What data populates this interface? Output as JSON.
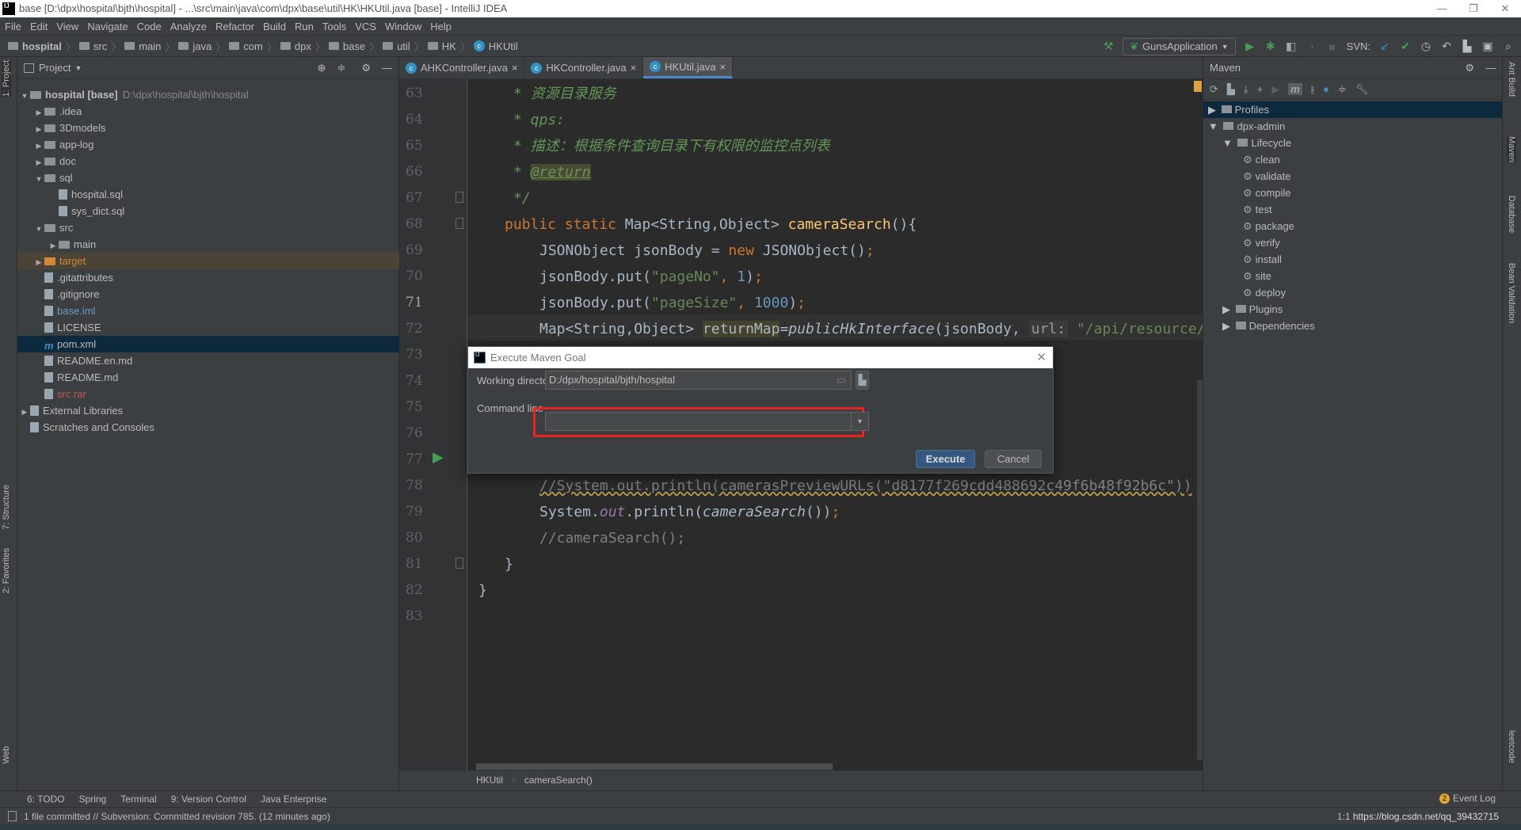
{
  "window": {
    "title": "base [D:\\dpx\\hospital\\bjth\\hospital] - ...\\src\\main\\java\\com\\dpx\\base\\util\\HK\\HKUtil.java [base] - IntelliJ IDEA",
    "logo": "IJ"
  },
  "menu": [
    "File",
    "Edit",
    "View",
    "Navigate",
    "Code",
    "Analyze",
    "Refactor",
    "Build",
    "Run",
    "Tools",
    "VCS",
    "Window",
    "Help"
  ],
  "navbar": [
    "hospital",
    "src",
    "main",
    "java",
    "com",
    "dpx",
    "base",
    "util",
    "HK",
    "HKUtil"
  ],
  "toolbar": {
    "run_config": "GunsApplication",
    "svn_label": "SVN:"
  },
  "left_stripe": [
    "1: Project",
    "7: Structure",
    "2: Favorites",
    "Web"
  ],
  "project": {
    "header": "Project",
    "tree": [
      {
        "label": "hospital [base]",
        "extra": "D:\\dpx\\hospital\\bjth\\hospital",
        "level": 0,
        "type": "folder",
        "expanded": true
      },
      {
        "label": ".idea",
        "level": 1,
        "type": "folder"
      },
      {
        "label": "3Dmodels",
        "level": 1,
        "type": "folder"
      },
      {
        "label": "app-log",
        "level": 1,
        "type": "folder"
      },
      {
        "label": "doc",
        "level": 1,
        "type": "folder"
      },
      {
        "label": "sql",
        "level": 1,
        "type": "folder",
        "expanded": true
      },
      {
        "label": "hospital.sql",
        "level": 2,
        "type": "file"
      },
      {
        "label": "sys_dict.sql",
        "level": 2,
        "type": "file"
      },
      {
        "label": "src",
        "level": 1,
        "type": "folder",
        "expanded": true
      },
      {
        "label": "main",
        "level": 2,
        "type": "folder"
      },
      {
        "label": "target",
        "level": 1,
        "type": "folder",
        "color": "#d08a36",
        "highlight": "#4b4335"
      },
      {
        "label": ".gitattributes",
        "level": 1,
        "type": "file"
      },
      {
        "label": ".gitignore",
        "level": 1,
        "type": "file"
      },
      {
        "label": "base.iml",
        "level": 1,
        "type": "file",
        "color": "#6c9dc6"
      },
      {
        "label": "LICENSE",
        "level": 1,
        "type": "file"
      },
      {
        "label": "pom.xml",
        "level": 1,
        "type": "file",
        "selected": true
      },
      {
        "label": "README.en.md",
        "level": 1,
        "type": "file"
      },
      {
        "label": "README.md",
        "level": 1,
        "type": "file"
      },
      {
        "label": "src.rar",
        "level": 1,
        "type": "file",
        "color": "#c75450"
      },
      {
        "label": "External Libraries",
        "level": 0,
        "type": "lib"
      },
      {
        "label": "Scratches and Consoles",
        "level": 0,
        "type": "scratch"
      }
    ]
  },
  "tabs": [
    {
      "label": "AHKController.java"
    },
    {
      "label": "HKController.java"
    },
    {
      "label": "HKUtil.java",
      "active": true
    }
  ],
  "editor": {
    "lines": [
      {
        "n": "63",
        "ind": 4,
        "t": [
          [
            "cm",
            "* 资源目录服务"
          ]
        ]
      },
      {
        "n": "64",
        "ind": 4,
        "t": [
          [
            "cm",
            "* qps:"
          ]
        ]
      },
      {
        "n": "65",
        "ind": 4,
        "t": [
          [
            "cm",
            "* 描述：根据条件查询目录下有权限的监控点列表"
          ]
        ]
      },
      {
        "n": "66",
        "ind": 4,
        "t": [
          [
            "cm",
            "* "
          ],
          [
            "tag",
            "@return"
          ]
        ]
      },
      {
        "n": "67",
        "ind": 4,
        "t": [
          [
            "cm",
            "*/"
          ]
        ]
      },
      {
        "n": "68",
        "ind": 3,
        "t": [
          [
            "kw",
            "public static "
          ],
          [
            "",
            "Map<String,Object> "
          ],
          [
            "fn",
            "cameraSearch"
          ],
          [
            "",
            "(){"
          ]
        ]
      },
      {
        "n": "69",
        "ind": 7,
        "t": [
          [
            "",
            "JSONObject jsonBody = "
          ],
          [
            "kw",
            "new "
          ],
          [
            "",
            "JSONObject()"
          ],
          [
            "kw",
            ";"
          ]
        ]
      },
      {
        "n": "70",
        "ind": 7,
        "t": [
          [
            "",
            "jsonBody.put("
          ],
          [
            "str",
            "\"pageNo\""
          ],
          [
            "kw",
            ", "
          ],
          [
            "num",
            "1"
          ],
          [
            "",
            ")"
          ],
          [
            "kw",
            ";"
          ]
        ]
      },
      {
        "n": "71",
        "ind": 7,
        "t": [
          [
            "",
            "jsonBody.put("
          ],
          [
            "str",
            "\"pageSize\""
          ],
          [
            "kw",
            ", "
          ],
          [
            "num",
            "1000"
          ],
          [
            "",
            ")"
          ],
          [
            "kw",
            ";"
          ]
        ]
      },
      {
        "n": "72",
        "ind": 7,
        "t": [
          [
            "",
            "Map<String,Object> "
          ],
          [
            "hl",
            "returnMap"
          ],
          [
            "",
            "="
          ],
          [
            "it",
            "publicHkInterface"
          ],
          [
            "",
            "(jsonBody, "
          ],
          [
            "hint",
            "url:"
          ],
          [
            "str",
            " \"/api/resource/"
          ]
        ]
      },
      {
        "n": "73",
        "ind": 0,
        "t": []
      },
      {
        "n": "74",
        "ind": 0,
        "t": []
      },
      {
        "n": "75",
        "ind": 0,
        "t": []
      },
      {
        "n": "76",
        "ind": 0,
        "t": []
      },
      {
        "n": "77",
        "ind": 0,
        "t": []
      },
      {
        "n": "78",
        "ind": 7,
        "t": [
          [
            "squig",
            "//System.out.println(camerasPreviewURLs(\"d8177f269cdd488692c49f6b48f92b6c\"))"
          ]
        ]
      },
      {
        "n": "79",
        "ind": 7,
        "t": [
          [
            "",
            "System."
          ],
          [
            "fieldit",
            "out"
          ],
          [
            "",
            ".println("
          ],
          [
            "it",
            "cameraSearch"
          ],
          [
            "",
            "())"
          ],
          [
            "kw",
            ";"
          ]
        ]
      },
      {
        "n": "80",
        "ind": 7,
        "t": [
          [
            "lc",
            "//cameraSearch();"
          ]
        ]
      },
      {
        "n": "81",
        "ind": 3,
        "t": [
          [
            "",
            "}"
          ]
        ]
      },
      {
        "n": "82",
        "ind": 0,
        "t": [
          [
            "",
            "}"
          ]
        ]
      },
      {
        "n": "83",
        "ind": 0,
        "t": []
      }
    ],
    "breadcrumb": [
      "HKUtil",
      "cameraSearch()"
    ]
  },
  "maven": {
    "title": "Maven",
    "tree": [
      {
        "label": "Profiles",
        "level": 0,
        "arrow": "right",
        "selected": true
      },
      {
        "label": "dpx-admin",
        "level": 0,
        "arrow": "down"
      },
      {
        "label": "Lifecycle",
        "level": 1,
        "arrow": "down"
      },
      {
        "label": "clean",
        "level": 2,
        "goal": true
      },
      {
        "label": "validate",
        "level": 2,
        "goal": true
      },
      {
        "label": "compile",
        "level": 2,
        "goal": true
      },
      {
        "label": "test",
        "level": 2,
        "goal": true
      },
      {
        "label": "package",
        "level": 2,
        "goal": true
      },
      {
        "label": "verify",
        "level": 2,
        "goal": true
      },
      {
        "label": "install",
        "level": 2,
        "goal": true
      },
      {
        "label": "site",
        "level": 2,
        "goal": true
      },
      {
        "label": "deploy",
        "level": 2,
        "goal": true
      },
      {
        "label": "Plugins",
        "level": 1,
        "arrow": "right"
      },
      {
        "label": "Dependencies",
        "level": 1,
        "arrow": "right"
      }
    ]
  },
  "right_stripe": [
    "Ant Build",
    "Maven",
    "Database",
    "Bean Validation",
    "leetcode"
  ],
  "dialog": {
    "title": "Execute Maven Goal",
    "working_dir_label": "Working directory",
    "working_dir_value": "D:/dpx/hospital/bjth/hospital",
    "command_label": "Command line",
    "command_value": "",
    "execute": "Execute",
    "cancel": "Cancel",
    "highlight_color": "#e8231f"
  },
  "toolwindows": [
    "6: TODO",
    "Spring",
    "Terminal",
    "9: Version Control",
    "Java Enterprise"
  ],
  "event_log": {
    "label": "Event Log",
    "count": "2"
  },
  "status": {
    "message": "1 file committed // Subversion: Committed revision 785. (12 minutes ago)",
    "position": "1:1",
    "watermark": "https://blog.csdn.net/qq_39432715"
  }
}
